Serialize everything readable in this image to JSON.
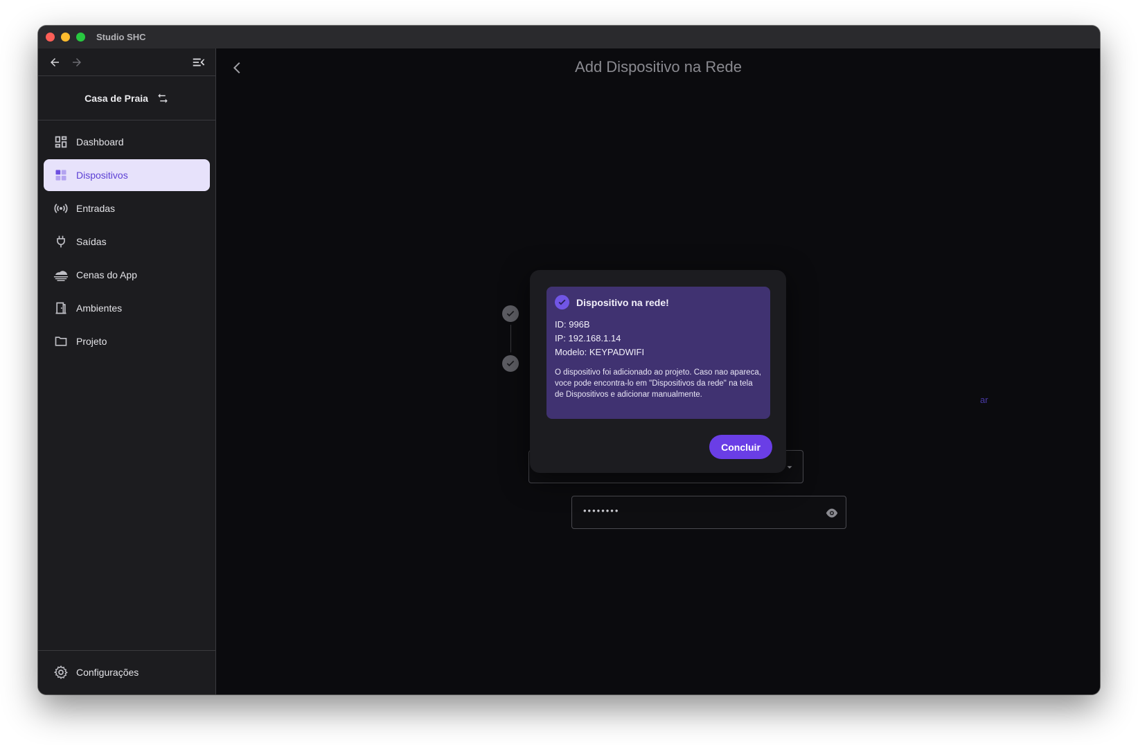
{
  "window": {
    "title": "Studio SHC"
  },
  "sidebar": {
    "project_name": "Casa de Praia",
    "items": [
      {
        "label": "Dashboard",
        "icon": "dashboard-icon",
        "active": false
      },
      {
        "label": "Dispositivos",
        "icon": "devices-icon",
        "active": true
      },
      {
        "label": "Entradas",
        "icon": "broadcast-icon",
        "active": false
      },
      {
        "label": "Saídas",
        "icon": "plug-icon",
        "active": false
      },
      {
        "label": "Cenas do App",
        "icon": "cloud-scene-icon",
        "active": false
      },
      {
        "label": "Ambientes",
        "icon": "door-icon",
        "active": false
      },
      {
        "label": "Projeto",
        "icon": "folder-icon",
        "active": false
      }
    ],
    "settings_label": "Configurações"
  },
  "main": {
    "title": "Add Dispositivo na Rede",
    "password_mask": "••••••••",
    "link_fragment": "ar"
  },
  "dialog": {
    "heading": "Dispositivo na rede!",
    "id_line": "ID: 996B",
    "ip_line": "IP: 192.168.1.14",
    "model_line": "Modelo: KEYPADWIFI",
    "description": "O dispositivo foi adicionado ao projeto. Caso nao apareca, voce pode encontra-lo em \"Dispositivos da rede\" na tela de Dispositivos e adicionar manualmente.",
    "confirm_label": "Concluir"
  },
  "colors": {
    "accent": "#6a3ee6",
    "alert_bg": "#403271",
    "active_item_bg": "#e7e2fb"
  }
}
